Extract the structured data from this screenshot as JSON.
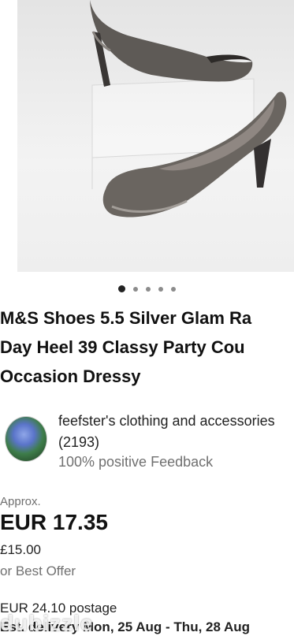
{
  "listing": {
    "title_lines": [
      "M&S Shoes 5.5 Silver Glam Ra",
      "Day Heel 39 Classy Party Cou",
      "Occasion Dressy"
    ],
    "image_count": 5,
    "active_image": 1
  },
  "seller": {
    "name": "feefster's clothing and accessories",
    "count": "(2193)",
    "feedback": "100% positive Feedback"
  },
  "pricing": {
    "approx_label": "Approx.",
    "price": "EUR 17.35",
    "original_price": "£15.00",
    "offer": "or Best Offer",
    "postage": "EUR 24.10 postage",
    "delivery": "Est. delivery Mon, 25 Aug - Thu, 28 Aug"
  },
  "watermark": "dubizzle",
  "colors": {
    "text": "#111111",
    "muted": "#707070"
  }
}
